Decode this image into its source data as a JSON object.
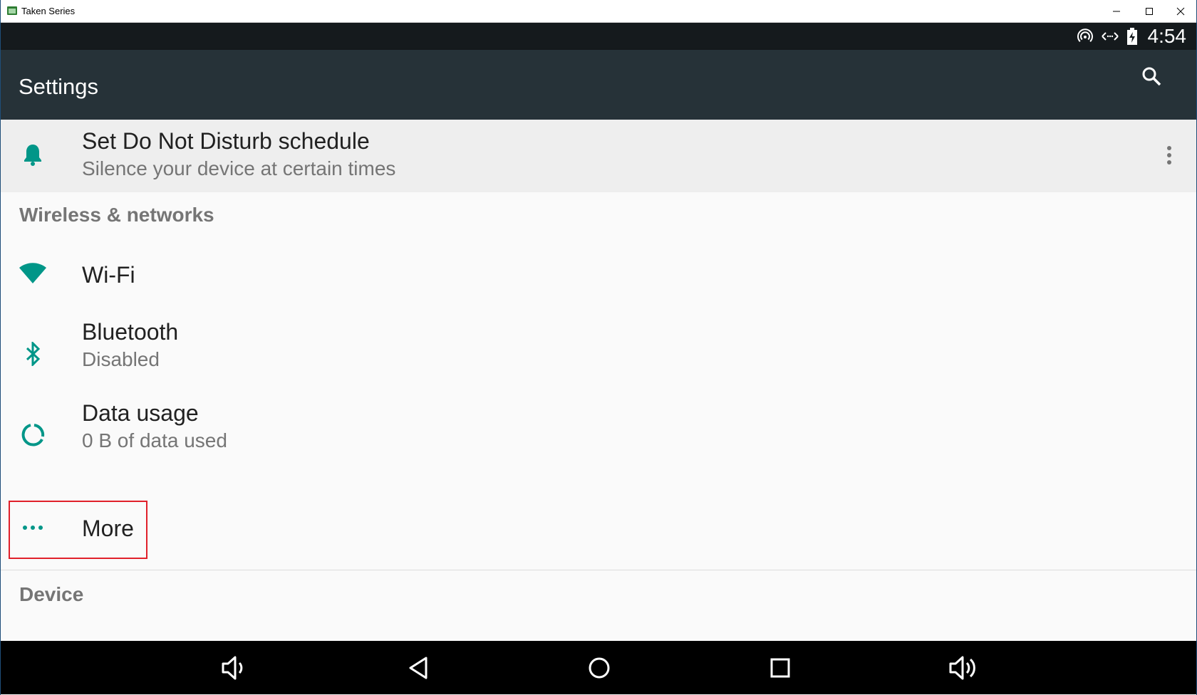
{
  "window": {
    "title": "Taken Series",
    "app_icon": "android-app-icon",
    "controls": [
      "minimize",
      "maximize",
      "close"
    ]
  },
  "status_bar": {
    "time": "4:54",
    "icons": [
      "hotspot-icon",
      "data-transfer-icon",
      "battery-charging-icon"
    ]
  },
  "app_bar": {
    "title": "Settings",
    "search_icon": "search-icon"
  },
  "suggestion": {
    "title": "Set Do Not Disturb schedule",
    "summary": "Silence your device at certain times",
    "icon": "bell-icon",
    "overflow_icon": "more-vert-icon"
  },
  "sections": [
    {
      "header": "Wireless & networks",
      "items": [
        {
          "title": "Wi-Fi",
          "summary": "",
          "icon": "wifi-icon"
        },
        {
          "title": "Bluetooth",
          "summary": "Disabled",
          "icon": "bluetooth-icon"
        },
        {
          "title": "Data usage",
          "summary": "0 B of data used",
          "icon": "data-usage-icon"
        },
        {
          "title": "More",
          "summary": "",
          "icon": "more-horiz-icon"
        }
      ]
    },
    {
      "header": "Device",
      "items": []
    }
  ],
  "nav_bar": {
    "buttons": [
      "volume-down-icon",
      "back-icon",
      "home-icon",
      "recents-icon",
      "volume-up-icon"
    ]
  },
  "colors": {
    "accent": "#009688",
    "app_bar": "#263238",
    "status_bar": "#151a1d",
    "highlight_box": "#e0202a"
  }
}
